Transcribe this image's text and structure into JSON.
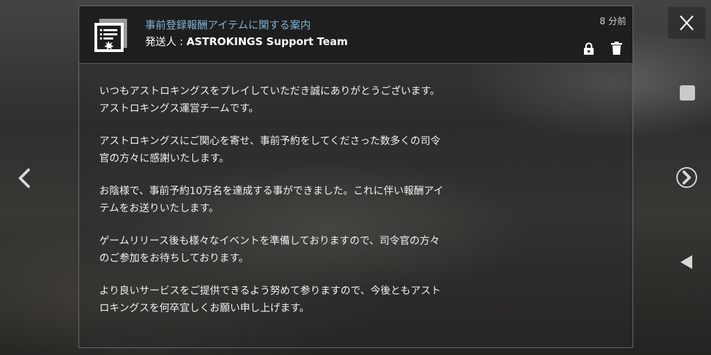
{
  "mail": {
    "title": "事前登録報酬アイテムに関する案内",
    "sender_label": "発送人 : ",
    "sender_name": "ASTROKINGS Support Team",
    "timestamp": "8 分前",
    "paragraphs": [
      [
        "いつもアストロキングスをプレイしていただき誠にありがとうございます。",
        "アストロキングス運営チームです。"
      ],
      [
        "アストロキングスにご関心を寄せ、事前予約をしてくださった数多くの司令",
        "官の方々に感謝いたします。"
      ],
      [
        "お陰様で、事前予約10万名を達成する事ができました。これに伴い報酬アイ",
        "テムをお送りいたします。"
      ],
      [
        "ゲームリリース後も様々なイベントを準備しておりますので、司令官の方々",
        "のご参加をお待ちしております。"
      ],
      [
        "より良いサービスをご提供できるよう努めて参りますので、今後ともアスト",
        "ロキングスを何卒宜しくお願い申し上げます。"
      ]
    ]
  },
  "icons": {
    "mail": "document-mail-icon",
    "lock": "lock-icon",
    "trash": "trash-icon",
    "close": "close-icon",
    "square": "square-icon",
    "next": "chevron-right-circle-icon",
    "play": "triangle-left-icon",
    "prev": "chevron-left-icon"
  },
  "colors": {
    "title": "#7fb2d8",
    "header_bg": "#1e1e1e",
    "text": "#f2f2f2"
  }
}
